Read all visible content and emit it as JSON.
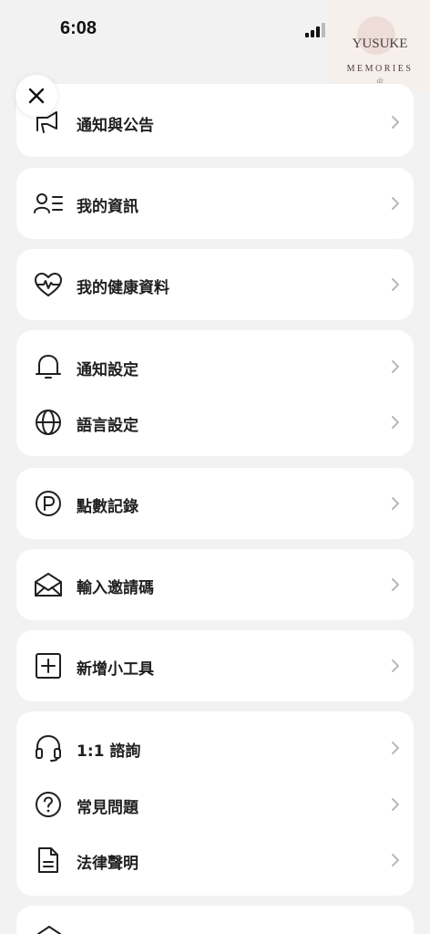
{
  "status_bar": {
    "time": "6:08"
  },
  "watermark": {
    "line1": "YUSUKE",
    "line2": "MEMORIES",
    "sign": "dz"
  },
  "menu": {
    "announcements": "通知與公告",
    "my_info": "我的資訊",
    "health_data": "我的健康資料",
    "notification_settings": "通知設定",
    "language_settings": "語言設定",
    "points_record": "點數記錄",
    "invite_code": "輸入邀請碼",
    "add_widget": "新增小工具",
    "consultation": "1:1 諮詢",
    "faq": "常見問題",
    "legal": "法律聲明"
  }
}
